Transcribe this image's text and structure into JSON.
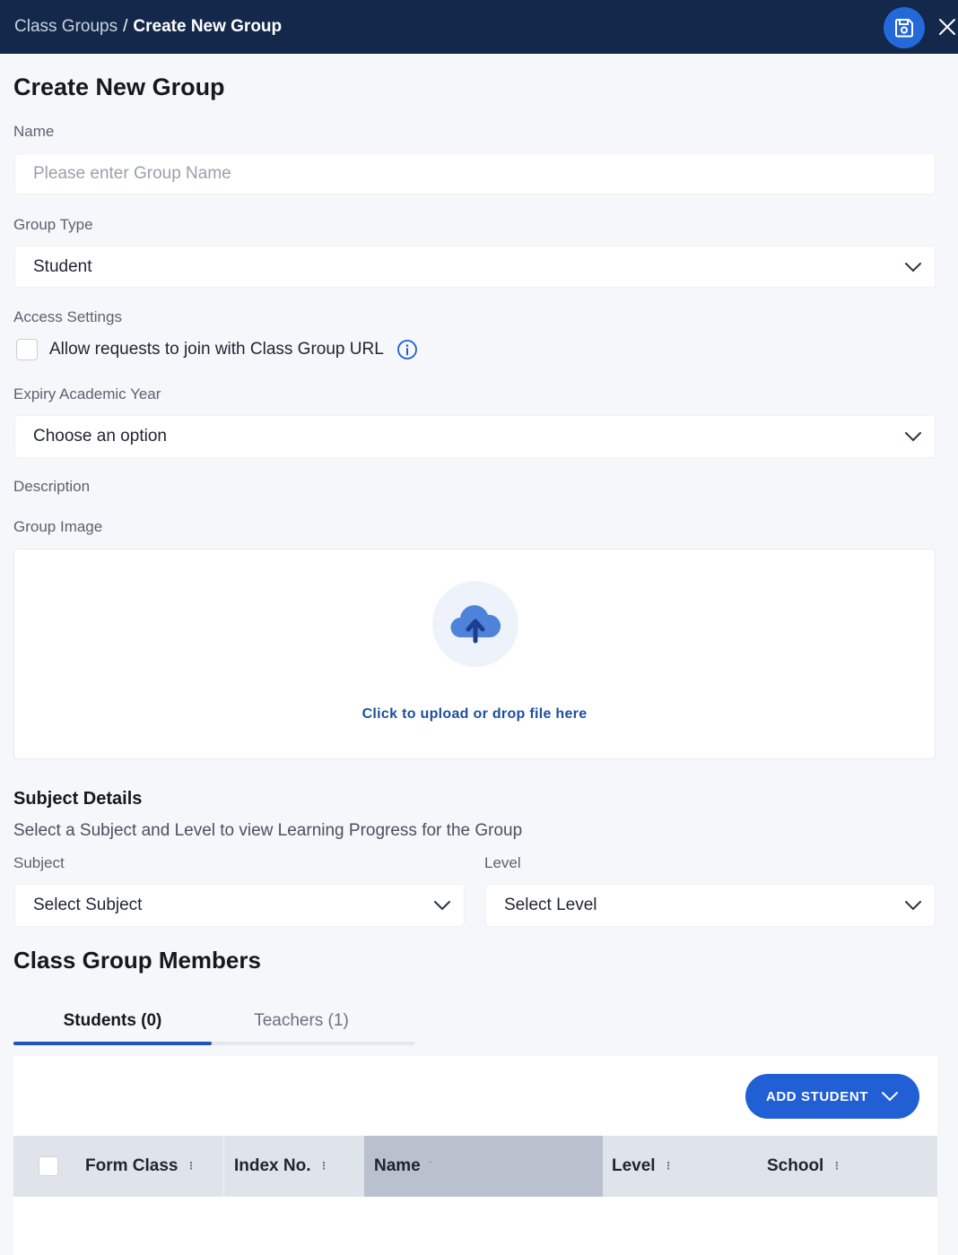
{
  "header": {
    "breadcrumb_parent": "Class Groups",
    "breadcrumb_separator": "/",
    "breadcrumb_current": "Create New Group",
    "save_icon": "save-icon",
    "close_icon": "close-icon"
  },
  "form": {
    "title": "Create New Group",
    "name_label": "Name",
    "name_placeholder": "Please enter Group Name",
    "name_value": "",
    "group_type_label": "Group Type",
    "group_type_value": "Student",
    "access_settings_label": "Access Settings",
    "allow_requests_label": "Allow requests to join with Class Group URL",
    "allow_requests_checked": false,
    "expiry_label": "Expiry Academic Year",
    "expiry_value": "Choose an option",
    "description_label": "Description",
    "group_image_label": "Group Image",
    "upload_text": "Click to upload or drop file here"
  },
  "subject_details": {
    "title": "Subject Details",
    "subtitle": "Select a Subject and Level to view Learning Progress for the Group",
    "subject_label": "Subject",
    "subject_value": "Select Subject",
    "level_label": "Level",
    "level_value": "Select Level"
  },
  "members": {
    "title": "Class Group Members",
    "tabs": [
      {
        "label": "Students (0)",
        "active": true
      },
      {
        "label": "Teachers (1)",
        "active": false
      }
    ],
    "add_button": "ADD STUDENT",
    "columns": [
      "Form Class",
      "Index No.",
      "Name",
      "Level",
      "School"
    ],
    "sorted_column": "Name",
    "rows": []
  },
  "colors": {
    "header_bg": "#13284a",
    "accent": "#2160d4",
    "table_header": "#dfe4ea",
    "sorted_header": "#b8c1cd"
  }
}
